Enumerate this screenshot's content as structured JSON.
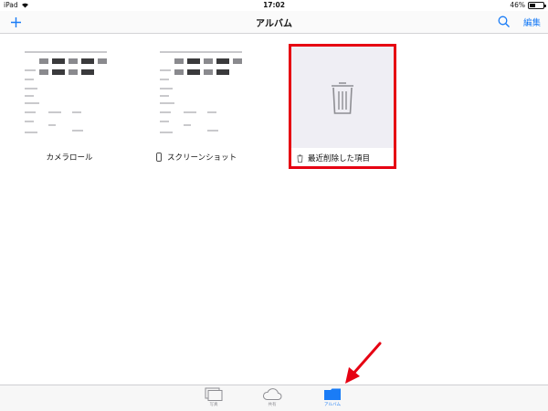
{
  "status_bar": {
    "device": "iPad",
    "time": "17:02",
    "battery": "46%",
    "battery_level": 0.46
  },
  "nav": {
    "title": "アルバム",
    "edit_label": "編集",
    "add_icon": "plus-icon",
    "search_icon": "search-icon"
  },
  "albums": [
    {
      "name": "カメラロール"
    },
    {
      "name": "スクリーンショット",
      "icon": "phone-icon"
    },
    {
      "name": "最近削除した項目",
      "icon": "trash-icon"
    }
  ],
  "tabs": [
    {
      "label": "写真",
      "icon": "photos-icon"
    },
    {
      "label": "共有",
      "icon": "cloud-icon"
    },
    {
      "label": "アルバム",
      "icon": "album-folder-icon",
      "selected": true
    }
  ],
  "colors": {
    "accent": "#1a7cf6",
    "highlight_border": "#e60012",
    "annotation_arrow": "#e60012"
  }
}
